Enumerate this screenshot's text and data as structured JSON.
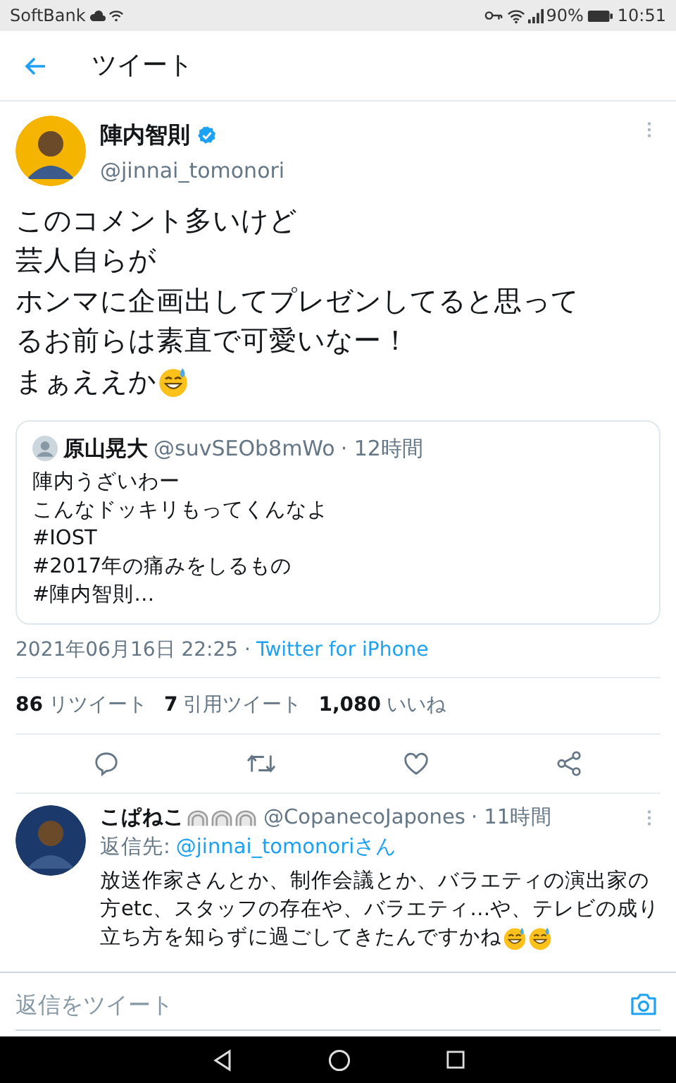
{
  "status_bar": {
    "carrier": "SoftBank",
    "battery": "90%",
    "time": "10:51"
  },
  "header": {
    "title": "ツイート"
  },
  "tweet": {
    "name": "陣内智則",
    "handle": "@jinnai_tomonori",
    "verified": true,
    "lines": [
      "このコメント多いけど",
      "芸人自らが",
      "ホンマに企画出してプレゼンしてると思って",
      "るお前らは素直で可愛いなー！",
      "まぁええか"
    ],
    "quote": {
      "name": "原山晃大",
      "handle": "@suvSEOb8mWo",
      "time": "· 12時間",
      "lines": [
        "陣内うざいわー",
        "こんなドッキリもってくんなよ",
        "#IOST",
        "#2017年の痛みをしるもの",
        "#陣内智則…"
      ]
    },
    "date": "2021年06月16日 22:25 ·",
    "source": "Twitter for iPhone",
    "stats": [
      {
        "count": "86",
        "label": "リツイート"
      },
      {
        "count": "7",
        "label": "引用ツイート"
      },
      {
        "count": "1,080",
        "label": "いいね"
      }
    ]
  },
  "reply": {
    "name": "こぱねこ",
    "handle": "@CopanecoJapones",
    "time": "· 11時間",
    "reply_to_label": "返信先:",
    "reply_to": "@jinnai_tomonoriさん",
    "lines": [
      "放送作家さんとか、制作会議とか、バラエティの演出家の",
      "方etc、スタッフの存在や、バラエティ…や、テレビの成り",
      "立ち方を知らずに過ごしてきたんですかね"
    ]
  },
  "compose": {
    "placeholder": "返信をツイート"
  }
}
